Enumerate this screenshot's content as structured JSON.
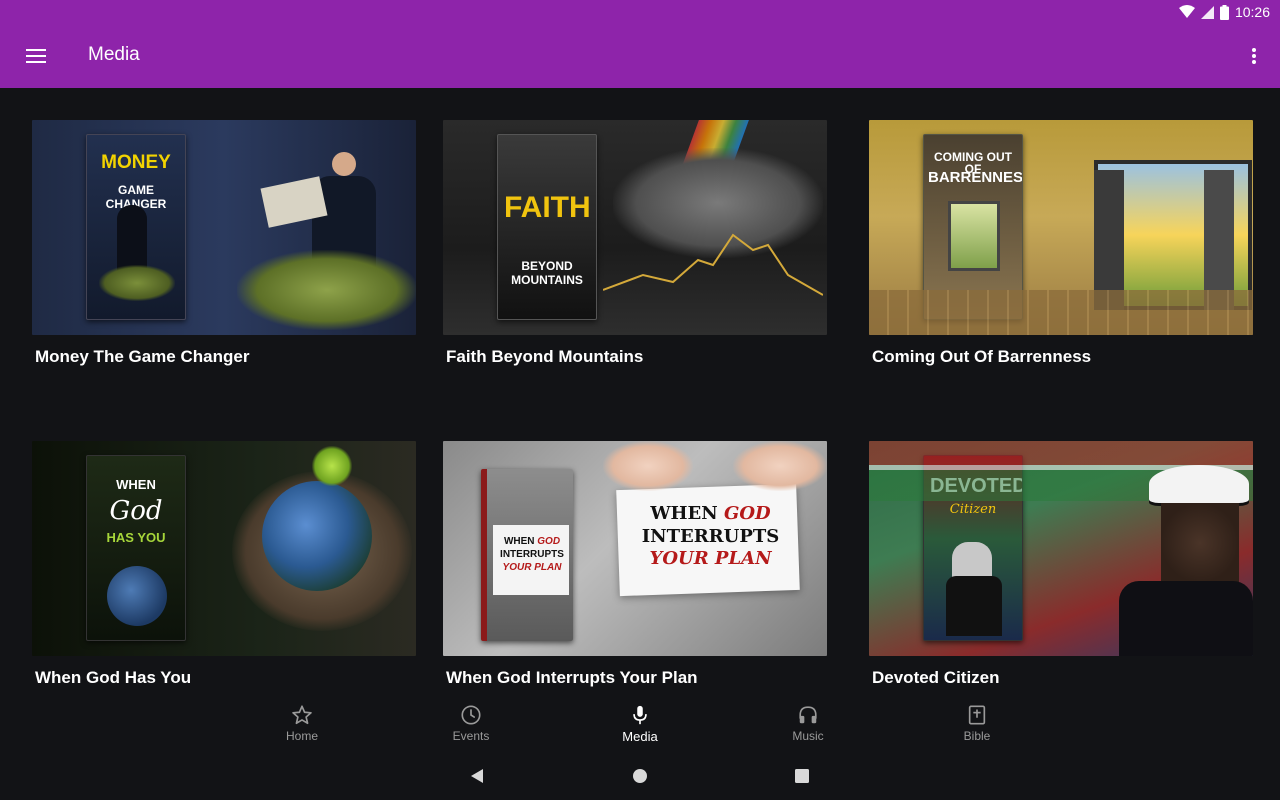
{
  "status": {
    "time": "10:26"
  },
  "appbar": {
    "title": "Media"
  },
  "items": [
    {
      "title": "Money The Game Changer",
      "cover_text": "MONEY\nGAME CHANGER"
    },
    {
      "title": "Faith Beyond Mountains",
      "cover_text": "FAITH\nBEYOND MOUNTAINS"
    },
    {
      "title": "Coming Out Of Barrenness",
      "cover_text": "COMING OUT OF\nBARRENNESS"
    },
    {
      "title": "When God Has You",
      "cover_text": "WHEN God HAS YOU"
    },
    {
      "title": "When God Interrupts Your Plan",
      "cover_text": "WHEN GOD INTERRUPTS YOUR PLAN"
    },
    {
      "title": "Devoted Citizen",
      "cover_text": "DEVOTED Citizen"
    }
  ],
  "nav": {
    "home": "Home",
    "events": "Events",
    "media": "Media",
    "music": "Music",
    "bible": "Bible"
  },
  "colors": {
    "appbar": "#8e24aa",
    "background": "#121316"
  }
}
